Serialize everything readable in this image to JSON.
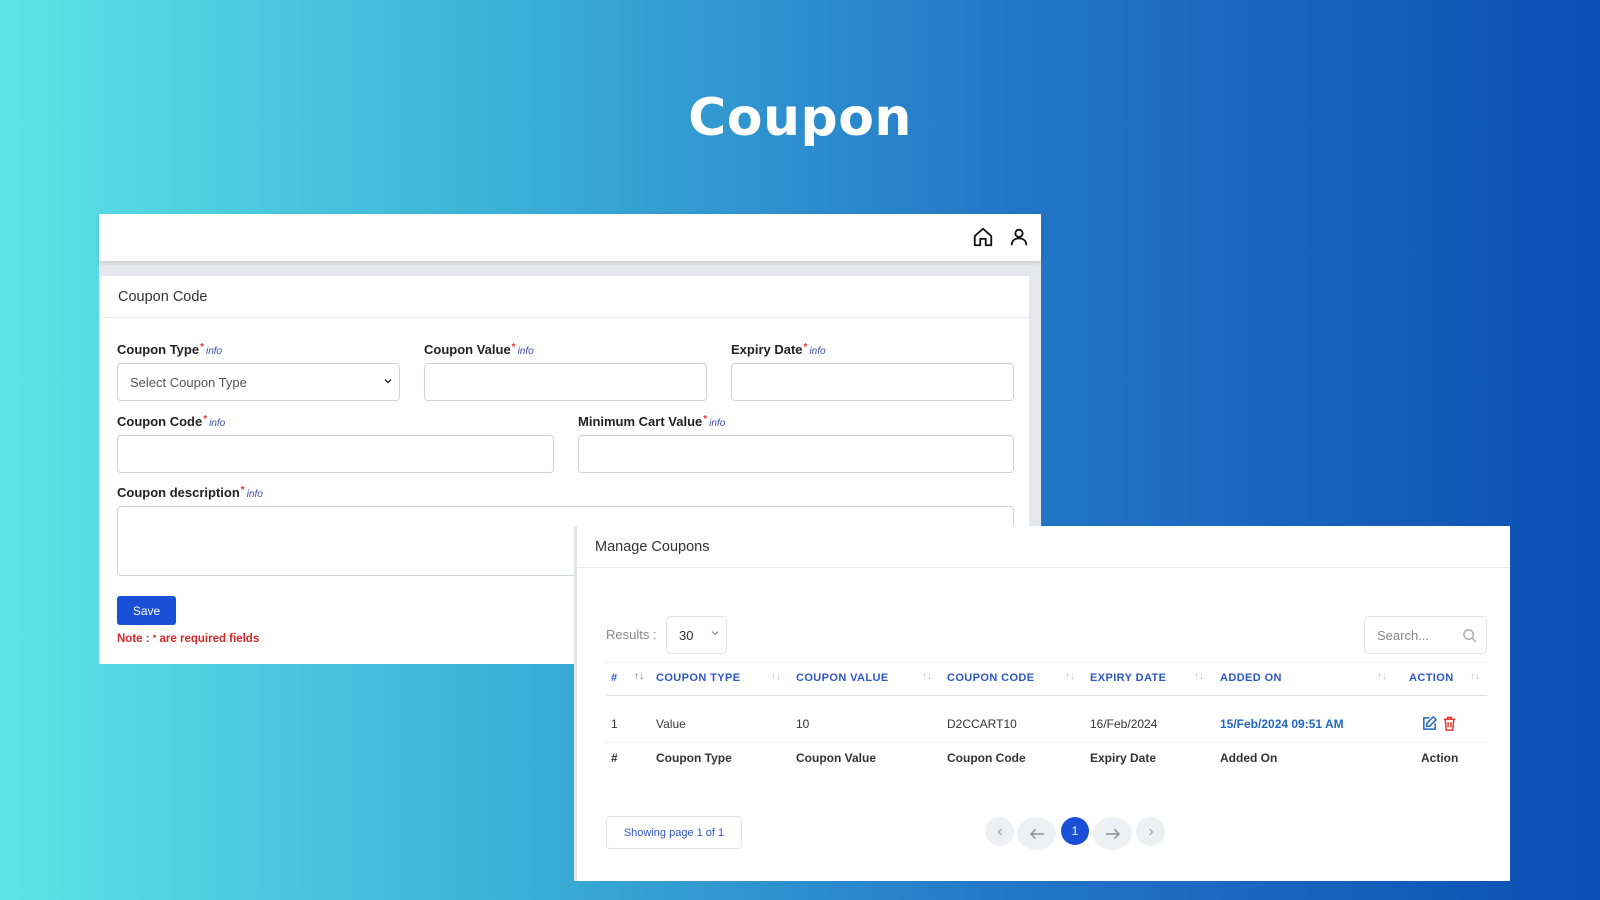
{
  "page": {
    "title": "Coupon"
  },
  "topbar": {
    "icons": [
      "home-icon",
      "user-icon"
    ]
  },
  "form": {
    "card_title": "Coupon Code",
    "required_mark": "*",
    "info_label": "info",
    "fields": {
      "coupon_type": {
        "label": "Coupon Type",
        "value": "Select Coupon Type"
      },
      "coupon_value": {
        "label": "Coupon Value",
        "value": ""
      },
      "expiry_date": {
        "label": "Expiry Date",
        "value": ""
      },
      "coupon_code": {
        "label": "Coupon Code",
        "value": ""
      },
      "minimum_cart_value": {
        "label": "Minimum Cart Value",
        "value": ""
      },
      "coupon_description": {
        "label": "Coupon description",
        "value": ""
      }
    },
    "save_label": "Save",
    "note_prefix": "Note :",
    "note_suffix": "are required fields"
  },
  "manage": {
    "title": "Manage Coupons",
    "results_label": "Results :",
    "results_value": "30",
    "search_placeholder": "Search...",
    "headers": [
      "#",
      "COUPON TYPE",
      "COUPON VALUE",
      "COUPON CODE",
      "EXPIRY DATE",
      "ADDED ON",
      "ACTION"
    ],
    "rows": [
      {
        "index": "1",
        "type": "Value",
        "value": "10",
        "code": "D2CCART10",
        "expiry": "16/Feb/2024",
        "added": "15/Feb/2024 09:51 AM"
      }
    ],
    "footer": [
      "#",
      "Coupon Type",
      "Coupon Value",
      "Coupon Code",
      "Expiry Date",
      "Added On",
      "Action"
    ],
    "showing": "Showing page 1 of 1",
    "current_page": "1"
  },
  "colors": {
    "primary": "#1a4fd8",
    "link": "#2f57c3",
    "required": "#e23b3b",
    "delete": "#e53935"
  }
}
